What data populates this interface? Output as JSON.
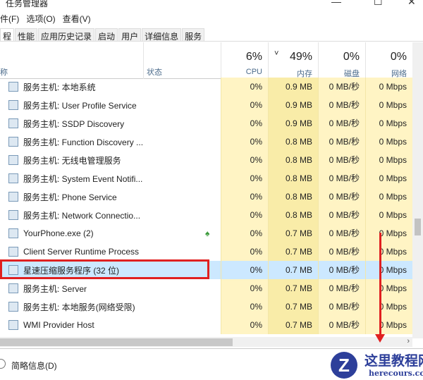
{
  "window": {
    "title": "任务管理器",
    "min": "—",
    "max": "☐",
    "close": "✕"
  },
  "menu": [
    "件(F)",
    "选项(O)",
    "查看(V)"
  ],
  "tabs": [
    "程",
    "性能",
    "应用历史记录",
    "启动",
    "用户",
    "详细信息",
    "服务"
  ],
  "columns": {
    "name": "称",
    "status": "状态",
    "cpu": {
      "pct": "6%",
      "label": "CPU"
    },
    "mem": {
      "pct": "49%",
      "label": "内存",
      "sort": "˅"
    },
    "disk": {
      "pct": "0%",
      "label": "磁盘"
    },
    "net": {
      "pct": "0%",
      "label": "网络"
    }
  },
  "rows": [
    {
      "name": "服务主机: 本地系统",
      "cpu": "0%",
      "mem": "0.9 MB",
      "disk": "0 MB/秒",
      "net": "0 Mbps"
    },
    {
      "name": "服务主机: User Profile Service",
      "cpu": "0%",
      "mem": "0.9 MB",
      "disk": "0 MB/秒",
      "net": "0 Mbps"
    },
    {
      "name": "服务主机: SSDP Discovery",
      "cpu": "0%",
      "mem": "0.9 MB",
      "disk": "0 MB/秒",
      "net": "0 Mbps"
    },
    {
      "name": "服务主机: Function Discovery ...",
      "cpu": "0%",
      "mem": "0.8 MB",
      "disk": "0 MB/秒",
      "net": "0 Mbps"
    },
    {
      "name": "服务主机: 无线电管理服务",
      "cpu": "0%",
      "mem": "0.8 MB",
      "disk": "0 MB/秒",
      "net": "0 Mbps"
    },
    {
      "name": "服务主机: System Event Notifi...",
      "cpu": "0%",
      "mem": "0.8 MB",
      "disk": "0 MB/秒",
      "net": "0 Mbps"
    },
    {
      "name": "服务主机: Phone Service",
      "cpu": "0%",
      "mem": "0.8 MB",
      "disk": "0 MB/秒",
      "net": "0 Mbps"
    },
    {
      "name": "服务主机: Network Connectio...",
      "cpu": "0%",
      "mem": "0.8 MB",
      "disk": "0 MB/秒",
      "net": "0 Mbps"
    },
    {
      "name": "YourPhone.exe (2)",
      "cpu": "0%",
      "mem": "0.7 MB",
      "disk": "0 MB/秒",
      "net": "0 Mbps",
      "status_icon": "leaf"
    },
    {
      "name": "Client Server Runtime Process",
      "cpu": "0%",
      "mem": "0.7 MB",
      "disk": "0 MB/秒",
      "net": "0 Mbps"
    },
    {
      "name": "星速压缩服务程序 (32 位)",
      "cpu": "0%",
      "mem": "0.7 MB",
      "disk": "0 MB/秒",
      "net": "0 Mbps",
      "selected": true
    },
    {
      "name": "服务主机: Server",
      "cpu": "0%",
      "mem": "0.7 MB",
      "disk": "0 MB/秒",
      "net": "0 Mbps"
    },
    {
      "name": "服务主机: 本地服务(网络受限)",
      "cpu": "0%",
      "mem": "0.7 MB",
      "disk": "0 MB/秒",
      "net": "0 Mbps"
    },
    {
      "name": "WMI Provider Host",
      "cpu": "0%",
      "mem": "0.7 MB",
      "disk": "0 MB/秒",
      "net": "0 Mbps"
    }
  ],
  "footer": {
    "label": "简略信息(D)"
  },
  "watermark": {
    "cn": "这里教程网",
    "en": "herecours.com",
    "letter": "Z"
  }
}
